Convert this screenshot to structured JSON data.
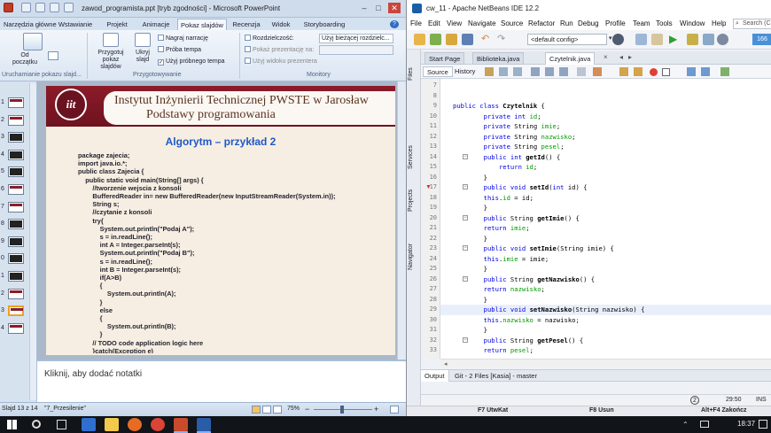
{
  "powerpoint": {
    "title": "zawod_programista.ppt [tryb zgodności] - Microsoft PowerPoint",
    "tabs": [
      "Narzędzia główne",
      "Wstawianie",
      "Projekt",
      "Animacje",
      "Pokaz slajdów",
      "Recenzja",
      "Widok",
      "Storyboarding"
    ],
    "active_tab": "Pokaz slajdów",
    "ribbon": {
      "od_poczatku": "Od początku",
      "group1_name": "Uruchamianie pokazu slajd...",
      "przygotuj": "Przygotuj pokaz slajdów",
      "ukryj": "Ukryj slajd",
      "nagraj": "Nagraj narrację",
      "proba": "Próba tempa",
      "uzyj_tempa": "Użyj próbnego tempa",
      "group2_name": "Przygotowywanie",
      "rozdzielczosc": "Rozdzielczość:",
      "rozdzielczosc_value": "Użyj bieżącej rozdzielc...",
      "pokaz_na": "Pokaż prezentację na:",
      "widok_prezentera": "Użyj widoku prezentera",
      "group3_name": "Monitory"
    },
    "slide_numbers": [
      "1",
      "2",
      "3",
      "4",
      "5",
      "6",
      "7",
      "8",
      "9",
      "0",
      "1",
      "2",
      "3",
      "4"
    ],
    "slide": {
      "logo_text": "iit",
      "institute_line1": "Instytut Inżynierii Technicznej PWSTE w Jarosław",
      "institute_line2": "Podstawy programowania",
      "title": "Algorytm – przykład 2",
      "code": [
        "package zajecia;",
        "import java.io.*;",
        "public class Zajecia {",
        "    public static void main(String[] args) {",
        "        //tworzenie wejscia z konsoli",
        "        BufferedReader in= new BufferedReader(new InputStreamReader(System.in));",
        "        String s;",
        "        //czytanie z konsoli",
        "        try{",
        "            System.out.println(\"Podaj A\");",
        "            s = in.readLine();",
        "            int A = Integer.parseInt(s);",
        "            System.out.println(\"Podaj B\");",
        "            s = in.readLine();",
        "            int B = Integer.parseInt(s);",
        "            if(A>B)",
        "            {",
        "                System.out.println(A);",
        "            }",
        "            else",
        "            {",
        "                System.out.println(B);",
        "            }",
        "        // TODO code application logic here",
        "        }catch(Exception e)"
      ]
    },
    "notes_placeholder": "Kliknij, aby dodać notatki",
    "status": {
      "slide_info": "Slajd 13 z 14",
      "theme": "\"7_Przesilenie\"",
      "zoom": "75%"
    }
  },
  "netbeans": {
    "title": "cw_11 - Apache NetBeans IDE 12.2",
    "menu": [
      "File",
      "Edit",
      "View",
      "Navigate",
      "Source",
      "Refactor",
      "Run",
      "Debug",
      "Profile",
      "Team",
      "Tools",
      "Window",
      "Help"
    ],
    "search_placeholder": "Search (C",
    "config": "<default config>",
    "memory": "166",
    "side_tabs": [
      "Files",
      "Services",
      "Projects",
      "Navigator"
    ],
    "editor_tabs": [
      "Start Page",
      "Biblioteka.java",
      "Czytelnik.java"
    ],
    "active_editor_tab": "Czytelnik.java",
    "source_label": "Source",
    "history_label": "History",
    "code_lines": [
      {
        "n": "7",
        "t": ""
      },
      {
        "n": "8",
        "t": ""
      },
      {
        "n": "9",
        "t": "public class Czytelnik {"
      },
      {
        "n": "10",
        "t": "        private int id;"
      },
      {
        "n": "11",
        "t": "        private String imie;"
      },
      {
        "n": "12",
        "t": "        private String nazwisko;"
      },
      {
        "n": "13",
        "t": "        private String pesel;"
      },
      {
        "n": "14",
        "t": "        public int getId() {"
      },
      {
        "n": "15",
        "t": "            return id;"
      },
      {
        "n": "16",
        "t": "        }"
      },
      {
        "n": "17",
        "t": "        public void setId(int id) {"
      },
      {
        "n": "18",
        "t": "        this.id = id;"
      },
      {
        "n": "19",
        "t": "        }"
      },
      {
        "n": "20",
        "t": "        public String getImie() {"
      },
      {
        "n": "21",
        "t": "        return imie;"
      },
      {
        "n": "22",
        "t": "        }"
      },
      {
        "n": "23",
        "t": "        public void setImie(String imie) {"
      },
      {
        "n": "24",
        "t": "        this.imie = imie;"
      },
      {
        "n": "25",
        "t": "        }"
      },
      {
        "n": "26",
        "t": "        public String getNazwisko() {"
      },
      {
        "n": "27",
        "t": "        return nazwisko;"
      },
      {
        "n": "28",
        "t": "        }"
      },
      {
        "n": "29",
        "t": "        public void setNazwisko(String nazwisko) {"
      },
      {
        "n": "30",
        "t": "        this.nazwisko = nazwisko;"
      },
      {
        "n": "31",
        "t": "        }"
      },
      {
        "n": "32",
        "t": "        public String getPesel() {"
      },
      {
        "n": "33",
        "t": "        return pesel;"
      }
    ],
    "output_tab": "Output",
    "git_tab": "Git - 2 Files [Kasia] - master",
    "status_badge": "2",
    "cursor_pos": "29:50",
    "insert_mode": "INS",
    "fkeys": [
      "F7 UtwKat",
      "F8 Usun",
      "Alt+F4 Zakończ"
    ]
  },
  "taskbar": {
    "clock": "18:37"
  }
}
